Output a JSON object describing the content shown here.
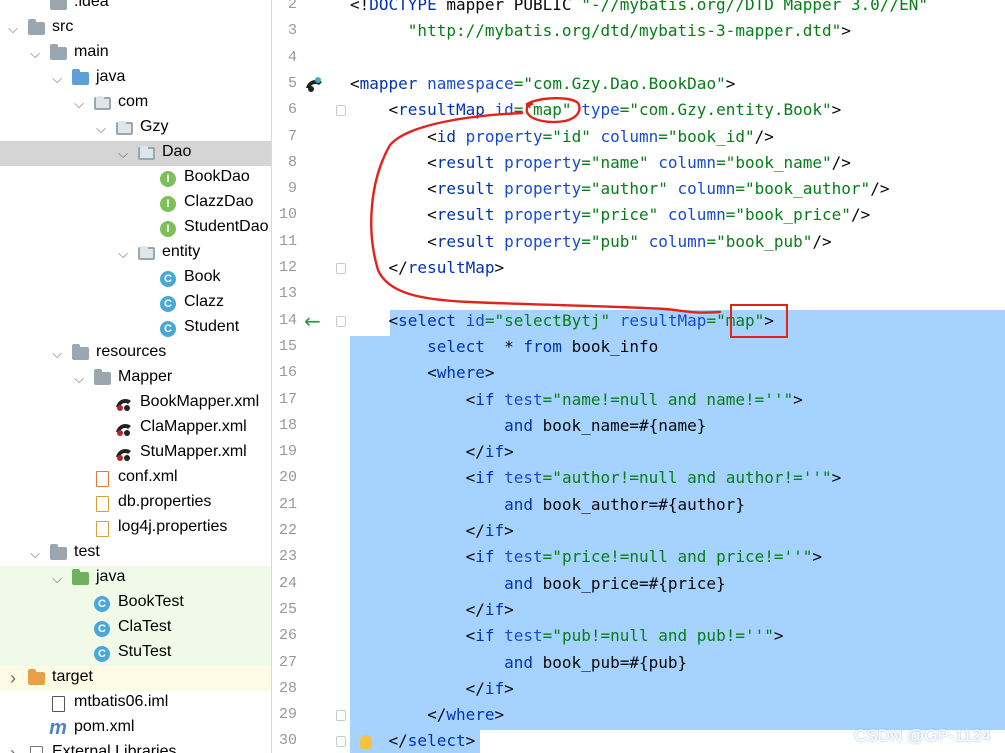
{
  "tree": {
    "items": [
      {
        "label": ".idea",
        "icon": "folder-icon",
        "color": "#9aa7b0"
      },
      {
        "label": "src",
        "icon": "folder-icon",
        "color": "#9aa7b0"
      },
      {
        "label": "main",
        "icon": "folder-icon",
        "color": "#9aa7b0"
      },
      {
        "label": "java",
        "icon": "source-folder-icon",
        "color": "#5e9fd6"
      },
      {
        "label": "com",
        "icon": "package-icon",
        "color": "#9aa7b0"
      },
      {
        "label": "Gzy",
        "icon": "package-icon",
        "color": "#9aa7b0"
      },
      {
        "label": "Dao",
        "icon": "package-icon",
        "color": "#9aa7b0"
      },
      {
        "label": "BookDao",
        "icon": "interface-icon",
        "color": "#7fbf5a",
        "glyph": "I"
      },
      {
        "label": "ClazzDao",
        "icon": "interface-icon",
        "color": "#7fbf5a",
        "glyph": "I"
      },
      {
        "label": "StudentDao",
        "icon": "interface-icon",
        "color": "#7fbf5a",
        "glyph": "I"
      },
      {
        "label": "entity",
        "icon": "package-icon",
        "color": "#9aa7b0"
      },
      {
        "label": "Book",
        "icon": "class-icon",
        "color": "#4aa8d8",
        "glyph": "C"
      },
      {
        "label": "Clazz",
        "icon": "class-icon",
        "color": "#4aa8d8",
        "glyph": "C"
      },
      {
        "label": "Student",
        "icon": "class-icon",
        "color": "#4aa8d8",
        "glyph": "C"
      },
      {
        "label": "resources",
        "icon": "resources-folder-icon",
        "color": "#9aa7b0"
      },
      {
        "label": "Mapper",
        "icon": "folder-icon",
        "color": "#9aa7b0"
      },
      {
        "label": "BookMapper.xml",
        "icon": "mybatis-xml-icon",
        "color": "#1a1a1a"
      },
      {
        "label": "ClaMapper.xml",
        "icon": "mybatis-xml-icon",
        "color": "#1a1a1a"
      },
      {
        "label": "StuMapper.xml",
        "icon": "mybatis-xml-icon",
        "color": "#1a1a1a"
      },
      {
        "label": "conf.xml",
        "icon": "xml-file-icon",
        "color": "#e07b3b"
      },
      {
        "label": "db.properties",
        "icon": "properties-file-icon",
        "color": "#d4a13a"
      },
      {
        "label": "log4j.properties",
        "icon": "properties-file-icon",
        "color": "#d4a13a"
      },
      {
        "label": "test",
        "icon": "folder-icon",
        "color": "#9aa7b0"
      },
      {
        "label": "java",
        "icon": "test-source-folder-icon",
        "color": "#6cb35b"
      },
      {
        "label": "BookTest",
        "icon": "test-class-icon",
        "color": "#4aa8d8",
        "glyph": "C"
      },
      {
        "label": "ClaTest",
        "icon": "test-class-icon",
        "color": "#4aa8d8",
        "glyph": "C"
      },
      {
        "label": "StuTest",
        "icon": "test-class-icon",
        "color": "#4aa8d8",
        "glyph": "C"
      },
      {
        "label": "target",
        "icon": "excluded-folder-icon",
        "color": "#e8a04a"
      },
      {
        "label": "mtbatis06.iml",
        "icon": "module-file-icon",
        "color": "#555555"
      },
      {
        "label": "pom.xml",
        "icon": "maven-pom-icon",
        "color": "#4a86c8",
        "glyph": "m"
      },
      {
        "label": "External Libraries",
        "icon": "libraries-icon",
        "color": "#777777"
      }
    ]
  },
  "editor": {
    "line_numbers": [
      "2",
      "3",
      "4",
      "5",
      "6",
      "7",
      "8",
      "9",
      "10",
      "11",
      "12",
      "13",
      "14",
      "15",
      "16",
      "17",
      "18",
      "19",
      "20",
      "21",
      "22",
      "23",
      "24",
      "25",
      "26",
      "27",
      "28",
      "29",
      "30"
    ],
    "lines": [
      [
        [
          "p",
          "<!"
        ],
        [
          "dt",
          "DOCTYPE "
        ],
        [
          "p",
          "mapper PUBLIC "
        ],
        [
          "s",
          "\"-//mybatis.org//DTD Mapper 3.0//EN\""
        ]
      ],
      [
        [
          "p",
          "      "
        ],
        [
          "s",
          "\"http://mybatis.org/dtd/mybatis-3-mapper.dtd\""
        ],
        [
          "p",
          ">"
        ]
      ],
      [],
      [
        [
          "p",
          "<"
        ],
        [
          "t",
          "mapper "
        ],
        [
          "a",
          "namespace"
        ],
        [
          "s",
          "=\"com.Gzy.Dao.BookDao\""
        ],
        [
          "p",
          ">"
        ]
      ],
      [
        [
          "p",
          "    <"
        ],
        [
          "t",
          "resultMap "
        ],
        [
          "a",
          "id"
        ],
        [
          "s",
          "=\"map\" "
        ],
        [
          "a",
          "type"
        ],
        [
          "s",
          "=\"com.Gzy.entity.Book\""
        ],
        [
          "p",
          ">"
        ]
      ],
      [
        [
          "p",
          "        <"
        ],
        [
          "t",
          "id "
        ],
        [
          "a",
          "property"
        ],
        [
          "s",
          "=\"id\" "
        ],
        [
          "a",
          "column"
        ],
        [
          "s",
          "=\"book_id\""
        ],
        [
          "p",
          "/>"
        ]
      ],
      [
        [
          "p",
          "        <"
        ],
        [
          "t",
          "result "
        ],
        [
          "a",
          "property"
        ],
        [
          "s",
          "=\"name\" "
        ],
        [
          "a",
          "column"
        ],
        [
          "s",
          "=\"book_name\""
        ],
        [
          "p",
          "/>"
        ]
      ],
      [
        [
          "p",
          "        <"
        ],
        [
          "t",
          "result "
        ],
        [
          "a",
          "property"
        ],
        [
          "s",
          "=\"author\" "
        ],
        [
          "a",
          "column"
        ],
        [
          "s",
          "=\"book_author\""
        ],
        [
          "p",
          "/>"
        ]
      ],
      [
        [
          "p",
          "        <"
        ],
        [
          "t",
          "result "
        ],
        [
          "a",
          "property"
        ],
        [
          "s",
          "=\"price\" "
        ],
        [
          "a",
          "column"
        ],
        [
          "s",
          "=\"book_price\""
        ],
        [
          "p",
          "/>"
        ]
      ],
      [
        [
          "p",
          "        <"
        ],
        [
          "t",
          "result "
        ],
        [
          "a",
          "property"
        ],
        [
          "s",
          "=\"pub\" "
        ],
        [
          "a",
          "column"
        ],
        [
          "s",
          "=\"book_pub\""
        ],
        [
          "p",
          "/>"
        ]
      ],
      [
        [
          "p",
          "    </"
        ],
        [
          "t",
          "resultMap"
        ],
        [
          "p",
          ">"
        ]
      ],
      [],
      [
        [
          "p",
          "    <"
        ],
        [
          "t",
          "select "
        ],
        [
          "a",
          "id"
        ],
        [
          "s",
          "=\"selectBytj\" "
        ],
        [
          "a",
          "resultMap"
        ],
        [
          "s",
          "=\"map\""
        ],
        [
          "p",
          ">"
        ]
      ],
      [
        [
          "p",
          "        "
        ],
        [
          "k",
          "select  "
        ],
        [
          "p",
          "* "
        ],
        [
          "k",
          "from "
        ],
        [
          "p",
          "book_info"
        ]
      ],
      [
        [
          "p",
          "        <"
        ],
        [
          "t",
          "where"
        ],
        [
          "p",
          ">"
        ]
      ],
      [
        [
          "p",
          "            <"
        ],
        [
          "t",
          "if "
        ],
        [
          "a",
          "test"
        ],
        [
          "s",
          "=\"name!=null and name!=''\""
        ],
        [
          "p",
          ">"
        ]
      ],
      [
        [
          "p",
          "                "
        ],
        [
          "k",
          "and "
        ],
        [
          "p",
          "book_name=#{name}"
        ]
      ],
      [
        [
          "p",
          "            </"
        ],
        [
          "t",
          "if"
        ],
        [
          "p",
          ">"
        ]
      ],
      [
        [
          "p",
          "            <"
        ],
        [
          "t",
          "if "
        ],
        [
          "a",
          "test"
        ],
        [
          "s",
          "=\"author!=null and author!=''\""
        ],
        [
          "p",
          ">"
        ]
      ],
      [
        [
          "p",
          "                "
        ],
        [
          "k",
          "and "
        ],
        [
          "p",
          "book_author=#{author}"
        ]
      ],
      [
        [
          "p",
          "            </"
        ],
        [
          "t",
          "if"
        ],
        [
          "p",
          ">"
        ]
      ],
      [
        [
          "p",
          "            <"
        ],
        [
          "t",
          "if "
        ],
        [
          "a",
          "test"
        ],
        [
          "s",
          "=\"price!=null and price!=''\""
        ],
        [
          "p",
          ">"
        ]
      ],
      [
        [
          "p",
          "                "
        ],
        [
          "k",
          "and "
        ],
        [
          "p",
          "book_price=#{price}"
        ]
      ],
      [
        [
          "p",
          "            </"
        ],
        [
          "t",
          "if"
        ],
        [
          "p",
          ">"
        ]
      ],
      [
        [
          "p",
          "            <"
        ],
        [
          "t",
          "if "
        ],
        [
          "a",
          "test"
        ],
        [
          "s",
          "=\"pub!=null and pub!=''\""
        ],
        [
          "p",
          ">"
        ]
      ],
      [
        [
          "p",
          "                "
        ],
        [
          "k",
          "and "
        ],
        [
          "p",
          "book_pub=#{pub}"
        ]
      ],
      [
        [
          "p",
          "            </"
        ],
        [
          "t",
          "if"
        ],
        [
          "p",
          ">"
        ]
      ],
      [
        [
          "p",
          "        </"
        ],
        [
          "t",
          "where"
        ],
        [
          "p",
          ">"
        ]
      ],
      [
        [
          "p",
          "    </"
        ],
        [
          "t",
          "select"
        ],
        [
          "p",
          ">"
        ]
      ]
    ]
  },
  "watermark": "CSDN @GP-1124",
  "colors": {
    "selection": "#a6d2ff",
    "annotation_red": "#e2231a",
    "navigate_arrow": "#2e9a45"
  }
}
